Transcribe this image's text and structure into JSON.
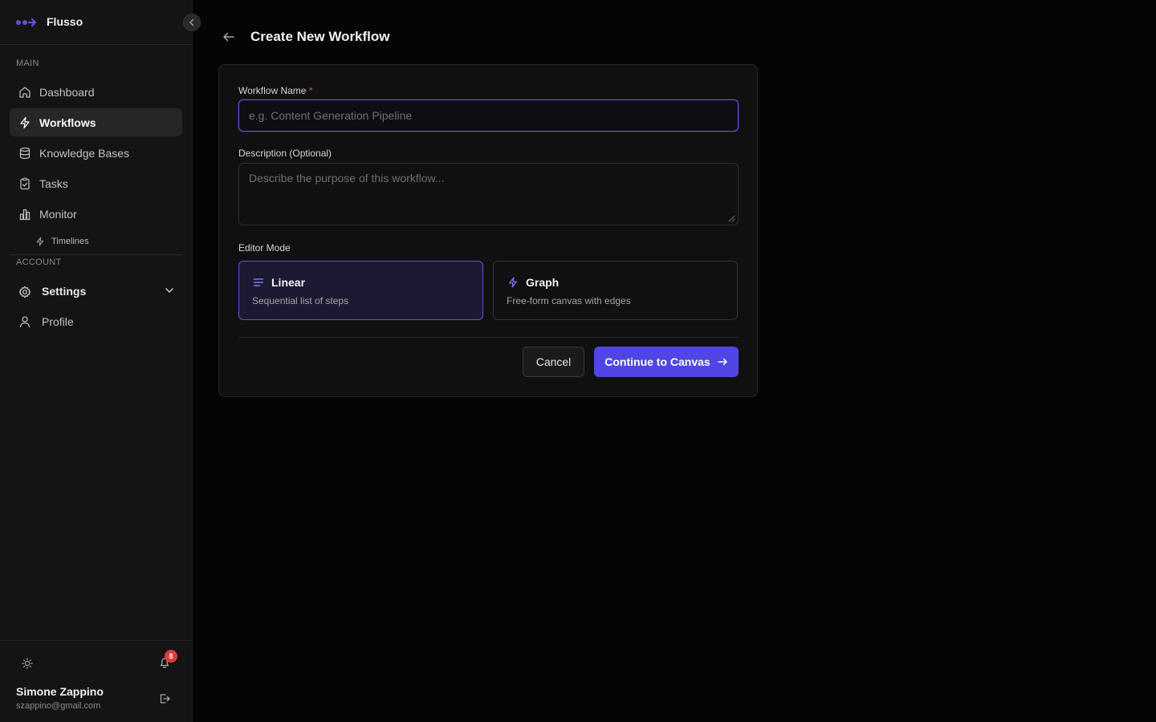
{
  "app": {
    "name": "Flusso"
  },
  "sidebar": {
    "main_label": "MAIN",
    "items": [
      {
        "label": "Dashboard",
        "icon": "home-icon"
      },
      {
        "label": "Workflows",
        "icon": "lightning-icon",
        "active": true
      },
      {
        "label": "Knowledge Bases",
        "icon": "database-icon"
      },
      {
        "label": "Tasks",
        "icon": "clipboard-icon"
      },
      {
        "label": "Monitor",
        "icon": "bar-chart-icon"
      }
    ],
    "sub_items": [
      {
        "label": "Timelines",
        "icon": "lightning-icon"
      }
    ],
    "account_label": "ACCOUNT",
    "account_items": [
      {
        "label": "Settings",
        "icon": "gear-icon",
        "expandable": true
      },
      {
        "label": "Profile",
        "icon": "user-icon"
      }
    ]
  },
  "footer": {
    "notifications_count": "8",
    "user_name": "Simone Zappino",
    "user_email": "szappino@gmail.com"
  },
  "page": {
    "title": "Create New Workflow"
  },
  "form": {
    "name_label": "Workflow Name",
    "name_required": "*",
    "name_value": "",
    "name_placeholder": "e.g. Content Generation Pipeline",
    "description_label": "Description (Optional)",
    "description_value": "",
    "description_placeholder": "Describe the purpose of this workflow...",
    "editor_mode_label": "Editor Mode",
    "modes": [
      {
        "title": "Linear",
        "description": "Sequential list of steps",
        "selected": true,
        "icon": "list-icon"
      },
      {
        "title": "Graph",
        "description": "Free-form canvas with edges",
        "selected": false,
        "icon": "lightning-icon"
      }
    ],
    "cancel_label": "Cancel",
    "continue_label": "Continue to Canvas"
  },
  "colors": {
    "accent": "#4f46e5",
    "accent_border": "#5b54d6",
    "selected_bg": "#1c1a33",
    "badge": "#e23b3b",
    "background": "#050505",
    "sidebar": "#141414"
  }
}
